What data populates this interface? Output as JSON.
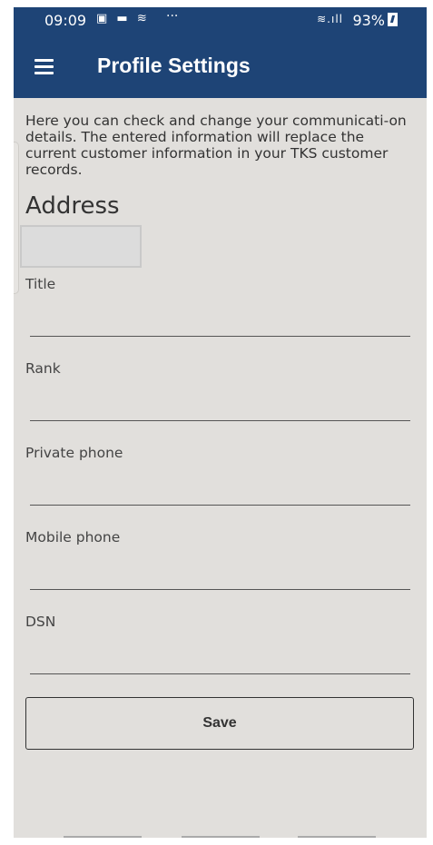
{
  "status_bar": {
    "time": "09:09",
    "notification_icons": "▣ ▬ ≋",
    "more": "···",
    "signal": "≋.ıll",
    "battery_percent": "93%"
  },
  "app_bar": {
    "menu_icon": "hamburger-menu-icon",
    "title": "Profile Settings"
  },
  "intro_text": "Here you can check and change your communicati-on details. The entered information will replace the current customer information in your TKS customer records.",
  "address": {
    "heading": "Address"
  },
  "fields": [
    {
      "label": "Title",
      "value": ""
    },
    {
      "label": "Rank",
      "value": ""
    },
    {
      "label": "Private phone",
      "value": ""
    },
    {
      "label": "Mobile phone",
      "value": ""
    },
    {
      "label": "DSN",
      "value": ""
    }
  ],
  "save_label": "Save",
  "colors": {
    "header": "#1e4476",
    "background": "#e1dfdc"
  }
}
